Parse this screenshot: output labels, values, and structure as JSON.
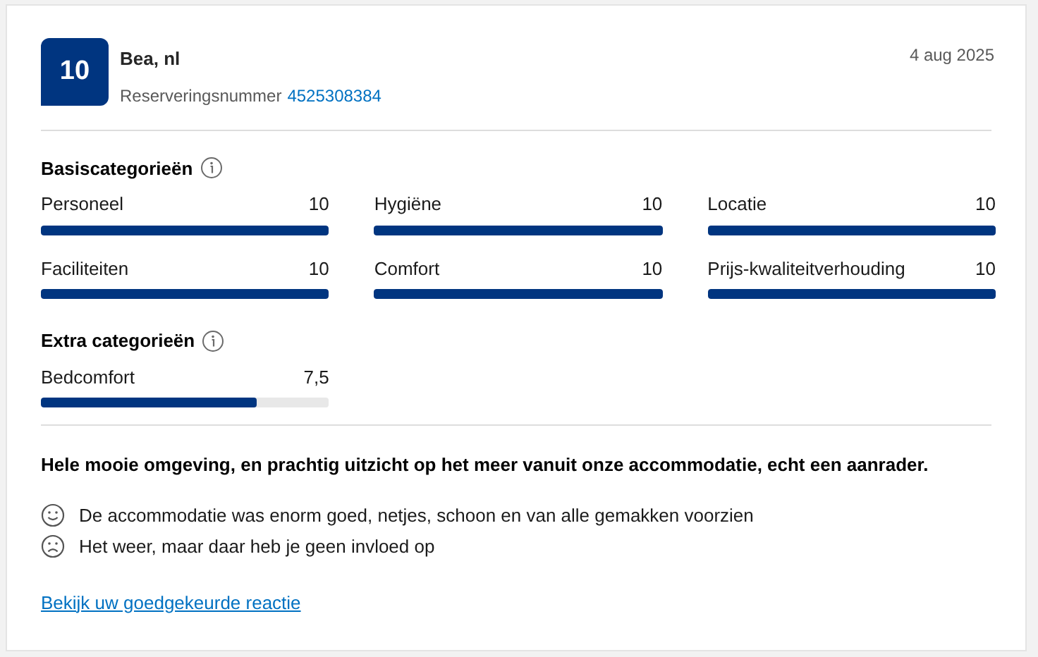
{
  "review": {
    "score": "10",
    "reviewer": "Bea, nl",
    "reservation_label": "Reserveringsnummer",
    "reservation_number": "4525308384",
    "date": "4 aug 2025"
  },
  "sections": [
    {
      "title": "Basiscategorieën",
      "categories": [
        {
          "name": "Personeel",
          "score": "10",
          "level": 1
        },
        {
          "name": "Hygiëne",
          "score": "10",
          "level": 1
        },
        {
          "name": "Locatie",
          "score": "10",
          "level": 1
        },
        {
          "name": "Faciliteiten",
          "score": "10",
          "level": 1
        },
        {
          "name": "Comfort",
          "score": "10",
          "level": 1
        },
        {
          "name": "Prijs-kwaliteitverhouding",
          "score": "10",
          "level": 1
        }
      ]
    },
    {
      "title": "Extra categorieën",
      "categories": [
        {
          "name": "Bedcomfort",
          "score": "7,5",
          "level": 0.75
        }
      ]
    }
  ],
  "headline": "Hele mooie omgeving, en prachtig uitzicht op het meer vanuit onze accommodatie, echt een aanrader.",
  "comments": [
    {
      "kind": "positive",
      "text": "De accommodatie was enorm goed, netjes, schoon en van alle gemakken voorzien"
    },
    {
      "kind": "negative",
      "text": "Het weer, maar daar heb je geen invloed op"
    }
  ],
  "link": "Bekijk uw goedgekeurde reactie"
}
